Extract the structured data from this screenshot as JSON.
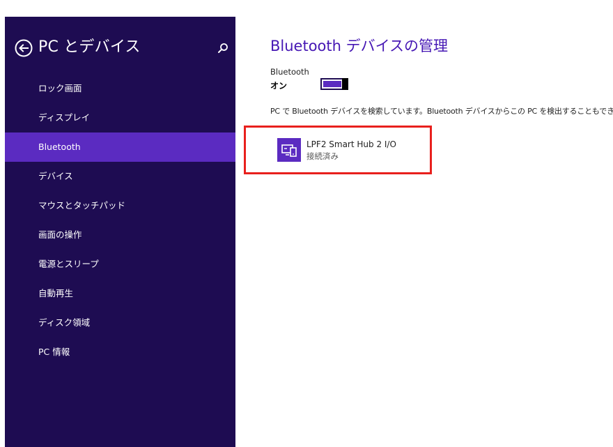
{
  "sidebar": {
    "title": "PC とデバイス",
    "items": [
      {
        "label": "ロック画面"
      },
      {
        "label": "ディスプレイ"
      },
      {
        "label": "Bluetooth",
        "selected": true
      },
      {
        "label": "デバイス"
      },
      {
        "label": "マウスとタッチパッド"
      },
      {
        "label": "画面の操作"
      },
      {
        "label": "電源とスリープ"
      },
      {
        "label": "自動再生"
      },
      {
        "label": "ディスク領域"
      },
      {
        "label": "PC 情報"
      }
    ]
  },
  "main": {
    "title": "Bluetooth デバイスの管理",
    "bluetooth_label": "Bluetooth",
    "bluetooth_state": "オン",
    "bluetooth_on": true,
    "info": "PC で Bluetooth デバイスを検索しています。Bluetooth デバイスからこの PC を検出することもできます。",
    "devices": [
      {
        "name": "LPF2 Smart Hub 2 I/O",
        "status": "接続済み"
      }
    ]
  },
  "icons": {
    "back": "back-arrow-circle-icon",
    "search": "search-icon",
    "device": "device-icon"
  },
  "colors": {
    "sidebar_bg": "#1e0c52",
    "accent": "#5b2bc1",
    "title_text": "#4617b4",
    "highlight_border": "#e8201d"
  }
}
